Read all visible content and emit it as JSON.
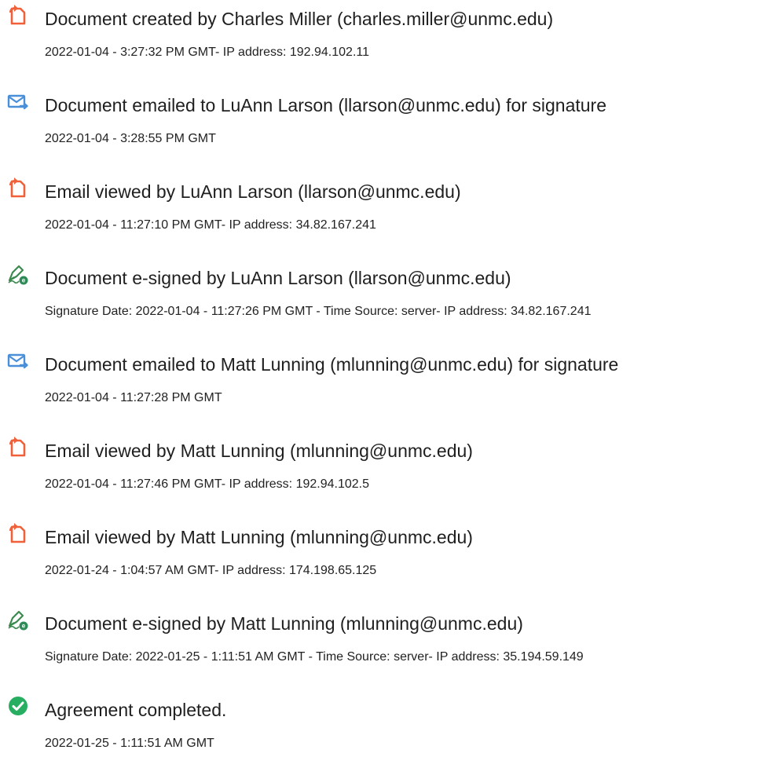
{
  "colors": {
    "document_icon": "#f0613a",
    "email_icon": "#4a90d9",
    "esign_icon": "#2e8b57",
    "complete_icon": "#27ae60"
  },
  "events": [
    {
      "icon": "document-created-icon",
      "title": "Document created by Charles Miller (charles.miller@unmc.edu)",
      "detail": "2022-01-04 - 3:27:32 PM GMT- IP address: 192.94.102.11"
    },
    {
      "icon": "email-sent-icon",
      "title": "Document emailed to LuAnn Larson (llarson@unmc.edu) for signature",
      "detail": "2022-01-04 - 3:28:55 PM GMT"
    },
    {
      "icon": "email-viewed-icon",
      "title": "Email viewed by LuAnn Larson (llarson@unmc.edu)",
      "detail": "2022-01-04 - 11:27:10 PM GMT- IP address: 34.82.167.241"
    },
    {
      "icon": "e-signed-icon",
      "title": "Document e-signed by LuAnn Larson (llarson@unmc.edu)",
      "detail": "Signature Date: 2022-01-04 - 11:27:26 PM GMT - Time Source: server- IP address: 34.82.167.241"
    },
    {
      "icon": "email-sent-icon",
      "title": "Document emailed to Matt Lunning (mlunning@unmc.edu) for signature",
      "detail": "2022-01-04 - 11:27:28 PM GMT"
    },
    {
      "icon": "email-viewed-icon",
      "title": "Email viewed by Matt Lunning (mlunning@unmc.edu)",
      "detail": "2022-01-04 - 11:27:46 PM GMT- IP address: 192.94.102.5"
    },
    {
      "icon": "email-viewed-icon",
      "title": "Email viewed by Matt Lunning (mlunning@unmc.edu)",
      "detail": "2022-01-24 - 1:04:57 AM GMT- IP address: 174.198.65.125"
    },
    {
      "icon": "e-signed-icon",
      "title": "Document e-signed by Matt Lunning (mlunning@unmc.edu)",
      "detail": "Signature Date: 2022-01-25 - 1:11:51 AM GMT - Time Source: server- IP address: 35.194.59.149"
    },
    {
      "icon": "agreement-completed-icon",
      "title": "Agreement completed.",
      "detail": "2022-01-25 - 1:11:51 AM GMT"
    }
  ]
}
